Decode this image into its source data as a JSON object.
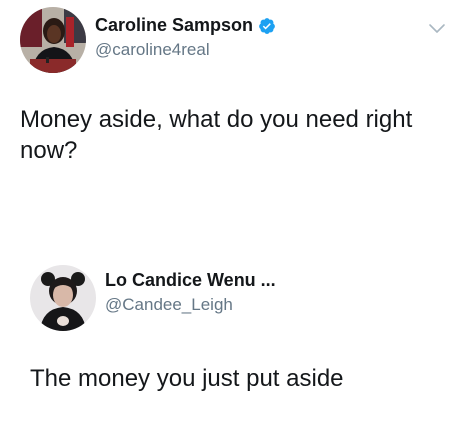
{
  "tweets": [
    {
      "display_name": "Caroline Sampson",
      "handle": "@caroline4real",
      "verified": true,
      "text": "Money aside, what do you need right now?",
      "avatar_icon": "profile-photo-caroline",
      "menu_icon": "chevron-down-icon"
    },
    {
      "display_name": "Lo Candice Wenu ...",
      "handle": "@Candee_Leigh",
      "verified": false,
      "text": "The money you just put aside",
      "avatar_icon": "profile-photo-candice"
    }
  ],
  "colors": {
    "text_primary": "#14171a",
    "text_secondary": "#657786",
    "verified_blue": "#1da1f2",
    "chevron_gray": "#aab8c2"
  }
}
